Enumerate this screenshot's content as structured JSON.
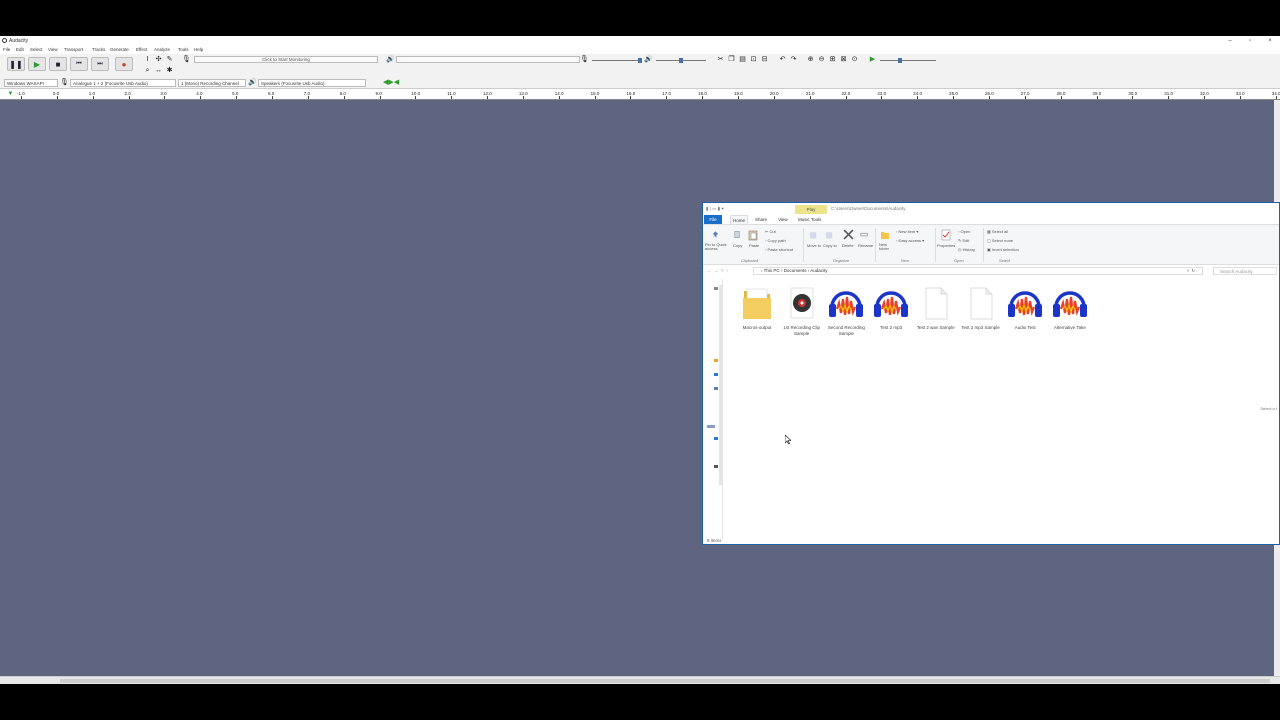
{
  "audacity": {
    "window_title": "Audacity",
    "menu": [
      "File",
      "Edit",
      "Select",
      "View",
      "Transport",
      "Tracks",
      "Generate",
      "Effect",
      "Analyze",
      "Tools",
      "Help"
    ],
    "monitor_label": "Click to Start Monitoring",
    "host": "Windows WASAPI",
    "input_device": "Analogue 1 + 2 (Focusrite Usb Audio)",
    "channels": "1 (Mono) Recording Channel",
    "output_device": "Speakers (Focusrite Usb Audio)",
    "ruler_ticks": [
      "-1.0",
      "0.0",
      "1.0",
      "2.0",
      "3.0",
      "4.0",
      "5.0",
      "6.0",
      "7.0",
      "8.0",
      "9.0",
      "10.0",
      "11.0",
      "12.0",
      "13.0",
      "14.0",
      "15.0",
      "16.0",
      "17.0",
      "18.0",
      "19.0",
      "20.0",
      "21.0",
      "22.0",
      "23.0",
      "24.0",
      "25.0",
      "26.0",
      "27.0",
      "28.0",
      "29.0",
      "30.0",
      "31.0",
      "32.0",
      "33.0",
      "34.0"
    ],
    "meter_scale": [
      "-54",
      "-48",
      "-42",
      "-18",
      "-12",
      "-6",
      "0"
    ],
    "colors": {
      "background": "#5f6580",
      "play": "#2e9b2e",
      "record": "#d63a2a"
    }
  },
  "explorer": {
    "title_path": "C:\\Users\\Owner\\Documents\\Audacity",
    "context_tab": "Play",
    "tabs": {
      "file": "File",
      "home": "Home",
      "share": "Share",
      "view": "View",
      "music_tools": "Music Tools"
    },
    "ribbon": {
      "pin": "Pin to Quick access",
      "copy": "Copy",
      "paste": "Paste",
      "cut": "Cut",
      "copy_path": "Copy path",
      "paste_shortcut": "Paste shortcut",
      "move_to": "Move to",
      "copy_to": "Copy to",
      "delete": "Delete",
      "rename": "Rename",
      "new_folder": "New folder",
      "new_item": "New item",
      "easy_access": "Easy access",
      "properties": "Properties",
      "open": "Open",
      "edit": "Edit",
      "history": "History",
      "select_all": "Select all",
      "select_none": "Select none",
      "invert_selection": "Invert selection",
      "group_clipboard": "Clipboard",
      "group_organize": "Organize",
      "group_new": "New",
      "group_open": "Open",
      "group_select": "Select"
    },
    "breadcrumb": [
      "This PC",
      "Documents",
      "Audacity"
    ],
    "search_placeholder": "Search Audacity",
    "files": [
      {
        "name": "Macros-output",
        "kind": "folder"
      },
      {
        "name": "1st Recording Clip Sample",
        "kind": "music"
      },
      {
        "name": "Second Recording Sample",
        "kind": "audacity"
      },
      {
        "name": "Test 2 mp3",
        "kind": "audacity"
      },
      {
        "name": "Test 2 wav Sample",
        "kind": "blank"
      },
      {
        "name": "Test 2 mp3 Sample",
        "kind": "blank"
      },
      {
        "name": "Audio Test",
        "kind": "audacity"
      },
      {
        "name": "Alternative Take",
        "kind": "audacity"
      }
    ],
    "status": "8 items",
    "selection_note": "Select a f"
  }
}
